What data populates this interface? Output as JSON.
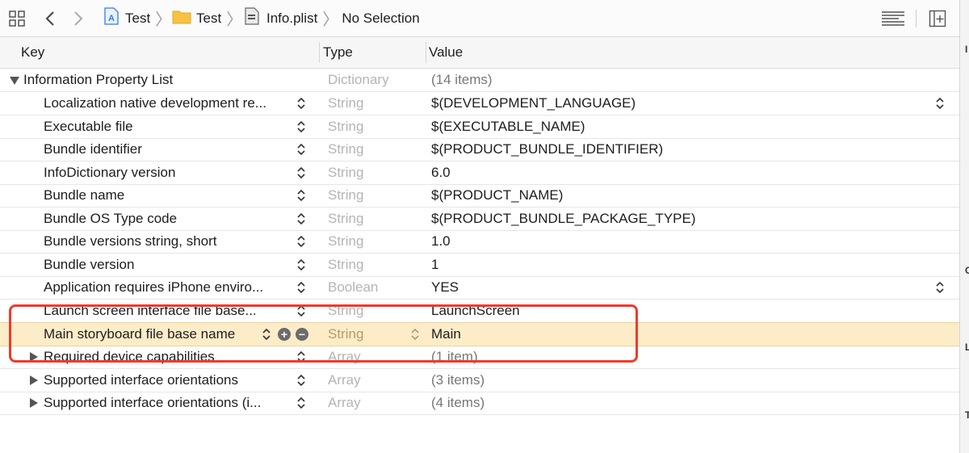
{
  "toolbar": {
    "breadcrumb": [
      {
        "label": "Test",
        "icon": "app-project-icon"
      },
      {
        "label": "Test",
        "icon": "folder-icon"
      },
      {
        "label": "Info.plist",
        "icon": "plist-file-icon"
      },
      {
        "label": "No Selection",
        "icon": ""
      }
    ]
  },
  "columns": {
    "key": "Key",
    "type": "Type",
    "value": "Value"
  },
  "rows": [
    {
      "key": "Information Property List",
      "type": "Dictionary",
      "value": "(14 items)"
    },
    {
      "key": "Localization native development re...",
      "type": "String",
      "value": "$(DEVELOPMENT_LANGUAGE)"
    },
    {
      "key": "Executable file",
      "type": "String",
      "value": "$(EXECUTABLE_NAME)"
    },
    {
      "key": "Bundle identifier",
      "type": "String",
      "value": "$(PRODUCT_BUNDLE_IDENTIFIER)"
    },
    {
      "key": "InfoDictionary version",
      "type": "String",
      "value": "6.0"
    },
    {
      "key": "Bundle name",
      "type": "String",
      "value": "$(PRODUCT_NAME)"
    },
    {
      "key": "Bundle OS Type code",
      "type": "String",
      "value": "$(PRODUCT_BUNDLE_PACKAGE_TYPE)"
    },
    {
      "key": "Bundle versions string, short",
      "type": "String",
      "value": "1.0"
    },
    {
      "key": "Bundle version",
      "type": "String",
      "value": "1"
    },
    {
      "key": "Application requires iPhone enviro...",
      "type": "Boolean",
      "value": "YES"
    },
    {
      "key": "Launch screen interface file base...",
      "type": "String",
      "value": "LaunchScreen"
    },
    {
      "key": "Main storyboard file base name",
      "type": "String",
      "value": "Main"
    },
    {
      "key": "Required device capabilities",
      "type": "Array",
      "value": "(1 item)"
    },
    {
      "key": "Supported interface orientations",
      "type": "Array",
      "value": "(3 items)"
    },
    {
      "key": "Supported interface orientations (i...",
      "type": "Array",
      "value": "(4 items)"
    }
  ],
  "inspector_letters": [
    "I",
    "C",
    "L",
    "T"
  ],
  "colors": {
    "selected_row": "#fcecc8",
    "highlight": "#f03a2c",
    "accent": "#2f7cf6"
  }
}
